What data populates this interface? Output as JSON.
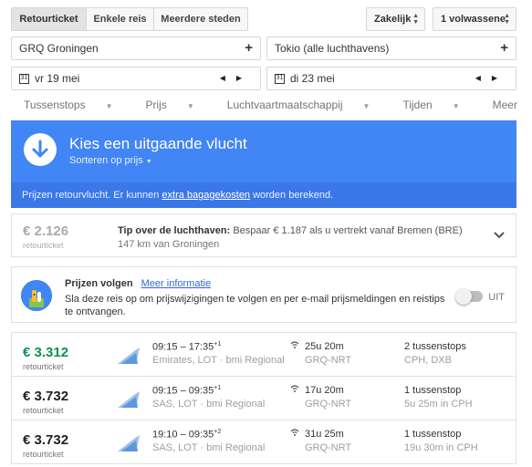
{
  "trip_type": {
    "options": [
      "Retourticket",
      "Enkele reis",
      "Meerdere steden"
    ],
    "active_index": 0
  },
  "cabin_select": {
    "value": "Zakelijk"
  },
  "passengers_select": {
    "value": "1 volwassene"
  },
  "origin": {
    "value": "GRQ Groningen",
    "add": "+"
  },
  "destination": {
    "value": "Tokio (alle luchthavens)",
    "add": "+"
  },
  "depart_date": {
    "value": "vr 19 mei",
    "cal": "31"
  },
  "return_date": {
    "value": "di 23 mei",
    "cal": "31"
  },
  "filters": [
    "Tussenstops",
    "Prijs",
    "Luchtvaartmaatschappij",
    "Tijden",
    "Meer"
  ],
  "banner": {
    "title": "Kies een uitgaande vlucht",
    "sort": "Sorteren op prijs",
    "note_before": "Prijzen retourvlucht. Er kunnen",
    "note_link": "extra bagagekosten",
    "note_after": "worden berekend."
  },
  "tip": {
    "price": "€ 2.126",
    "price_type": "retourticket",
    "label": "Tip over de luchthaven:",
    "text": "Bespaar € 1.187 als u vertrekt vanaf Bremen (BRE)",
    "distance": "147 km van Groningen"
  },
  "tracking": {
    "title": "Prijzen volgen",
    "link": "Meer informatie",
    "description": "Sla deze reis op om prijswijzigingen te volgen en per e-mail prijsmeldingen en reistips te ontvangen.",
    "toggle_label": "UIT",
    "enabled": false
  },
  "flights": [
    {
      "price": "€ 3.312",
      "price_type": "retourticket",
      "best": true,
      "times": "09:15 – 17:35",
      "day_offset": "+1",
      "airlines": "Emirates, LOT · bmi Regional",
      "duration": "25u 20m",
      "route": "GRQ-NRT",
      "stops": "2 tussenstops",
      "via": "CPH, DXB"
    },
    {
      "price": "€ 3.732",
      "price_type": "retourticket",
      "best": false,
      "times": "09:15 – 09:35",
      "day_offset": "+1",
      "airlines": "SAS, LOT · bmi Regional",
      "duration": "17u 20m",
      "route": "GRQ-NRT",
      "stops": "1 tussenstop",
      "via": "5u 25m in CPH"
    },
    {
      "price": "€ 3.732",
      "price_type": "retourticket",
      "best": false,
      "times": "19:10 – 09:35",
      "day_offset": "+2",
      "airlines": "SAS, LOT · bmi Regional",
      "duration": "31u 25m",
      "route": "GRQ-NRT",
      "stops": "1 tussenstop",
      "via": "19u 30m in CPH"
    }
  ],
  "colors": {
    "accent": "#4285f4",
    "best_price": "#0d904f",
    "link": "#3367d6"
  }
}
